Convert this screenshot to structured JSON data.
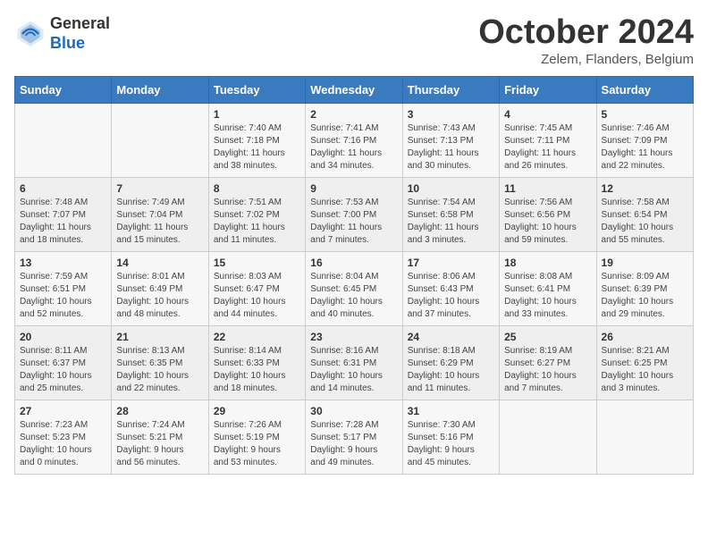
{
  "header": {
    "logo_line1": "General",
    "logo_line2": "Blue",
    "month": "October 2024",
    "location": "Zelem, Flanders, Belgium"
  },
  "days_of_week": [
    "Sunday",
    "Monday",
    "Tuesday",
    "Wednesday",
    "Thursday",
    "Friday",
    "Saturday"
  ],
  "weeks": [
    [
      {
        "day": "",
        "info": ""
      },
      {
        "day": "",
        "info": ""
      },
      {
        "day": "1",
        "info": "Sunrise: 7:40 AM\nSunset: 7:18 PM\nDaylight: 11 hours\nand 38 minutes."
      },
      {
        "day": "2",
        "info": "Sunrise: 7:41 AM\nSunset: 7:16 PM\nDaylight: 11 hours\nand 34 minutes."
      },
      {
        "day": "3",
        "info": "Sunrise: 7:43 AM\nSunset: 7:13 PM\nDaylight: 11 hours\nand 30 minutes."
      },
      {
        "day": "4",
        "info": "Sunrise: 7:45 AM\nSunset: 7:11 PM\nDaylight: 11 hours\nand 26 minutes."
      },
      {
        "day": "5",
        "info": "Sunrise: 7:46 AM\nSunset: 7:09 PM\nDaylight: 11 hours\nand 22 minutes."
      }
    ],
    [
      {
        "day": "6",
        "info": "Sunrise: 7:48 AM\nSunset: 7:07 PM\nDaylight: 11 hours\nand 18 minutes."
      },
      {
        "day": "7",
        "info": "Sunrise: 7:49 AM\nSunset: 7:04 PM\nDaylight: 11 hours\nand 15 minutes."
      },
      {
        "day": "8",
        "info": "Sunrise: 7:51 AM\nSunset: 7:02 PM\nDaylight: 11 hours\nand 11 minutes."
      },
      {
        "day": "9",
        "info": "Sunrise: 7:53 AM\nSunset: 7:00 PM\nDaylight: 11 hours\nand 7 minutes."
      },
      {
        "day": "10",
        "info": "Sunrise: 7:54 AM\nSunset: 6:58 PM\nDaylight: 11 hours\nand 3 minutes."
      },
      {
        "day": "11",
        "info": "Sunrise: 7:56 AM\nSunset: 6:56 PM\nDaylight: 10 hours\nand 59 minutes."
      },
      {
        "day": "12",
        "info": "Sunrise: 7:58 AM\nSunset: 6:54 PM\nDaylight: 10 hours\nand 55 minutes."
      }
    ],
    [
      {
        "day": "13",
        "info": "Sunrise: 7:59 AM\nSunset: 6:51 PM\nDaylight: 10 hours\nand 52 minutes."
      },
      {
        "day": "14",
        "info": "Sunrise: 8:01 AM\nSunset: 6:49 PM\nDaylight: 10 hours\nand 48 minutes."
      },
      {
        "day": "15",
        "info": "Sunrise: 8:03 AM\nSunset: 6:47 PM\nDaylight: 10 hours\nand 44 minutes."
      },
      {
        "day": "16",
        "info": "Sunrise: 8:04 AM\nSunset: 6:45 PM\nDaylight: 10 hours\nand 40 minutes."
      },
      {
        "day": "17",
        "info": "Sunrise: 8:06 AM\nSunset: 6:43 PM\nDaylight: 10 hours\nand 37 minutes."
      },
      {
        "day": "18",
        "info": "Sunrise: 8:08 AM\nSunset: 6:41 PM\nDaylight: 10 hours\nand 33 minutes."
      },
      {
        "day": "19",
        "info": "Sunrise: 8:09 AM\nSunset: 6:39 PM\nDaylight: 10 hours\nand 29 minutes."
      }
    ],
    [
      {
        "day": "20",
        "info": "Sunrise: 8:11 AM\nSunset: 6:37 PM\nDaylight: 10 hours\nand 25 minutes."
      },
      {
        "day": "21",
        "info": "Sunrise: 8:13 AM\nSunset: 6:35 PM\nDaylight: 10 hours\nand 22 minutes."
      },
      {
        "day": "22",
        "info": "Sunrise: 8:14 AM\nSunset: 6:33 PM\nDaylight: 10 hours\nand 18 minutes."
      },
      {
        "day": "23",
        "info": "Sunrise: 8:16 AM\nSunset: 6:31 PM\nDaylight: 10 hours\nand 14 minutes."
      },
      {
        "day": "24",
        "info": "Sunrise: 8:18 AM\nSunset: 6:29 PM\nDaylight: 10 hours\nand 11 minutes."
      },
      {
        "day": "25",
        "info": "Sunrise: 8:19 AM\nSunset: 6:27 PM\nDaylight: 10 hours\nand 7 minutes."
      },
      {
        "day": "26",
        "info": "Sunrise: 8:21 AM\nSunset: 6:25 PM\nDaylight: 10 hours\nand 3 minutes."
      }
    ],
    [
      {
        "day": "27",
        "info": "Sunrise: 7:23 AM\nSunset: 5:23 PM\nDaylight: 10 hours\nand 0 minutes."
      },
      {
        "day": "28",
        "info": "Sunrise: 7:24 AM\nSunset: 5:21 PM\nDaylight: 9 hours\nand 56 minutes."
      },
      {
        "day": "29",
        "info": "Sunrise: 7:26 AM\nSunset: 5:19 PM\nDaylight: 9 hours\nand 53 minutes."
      },
      {
        "day": "30",
        "info": "Sunrise: 7:28 AM\nSunset: 5:17 PM\nDaylight: 9 hours\nand 49 minutes."
      },
      {
        "day": "31",
        "info": "Sunrise: 7:30 AM\nSunset: 5:16 PM\nDaylight: 9 hours\nand 45 minutes."
      },
      {
        "day": "",
        "info": ""
      },
      {
        "day": "",
        "info": ""
      }
    ]
  ]
}
